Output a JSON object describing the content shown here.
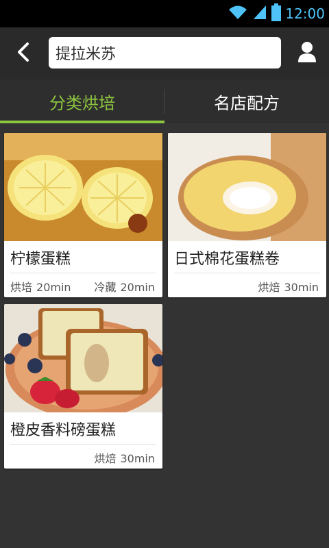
{
  "status_bar": {
    "time": "12:00"
  },
  "header": {
    "search_value": "提拉米苏",
    "back_icon": "chevron-left-icon",
    "user_icon": "user-icon"
  },
  "tabs": [
    {
      "label": "分类烘培",
      "active": true
    },
    {
      "label": "名店配方",
      "active": false
    }
  ],
  "colors": {
    "accent": "#8dc63f",
    "background": "#333333",
    "card": "#ffffff",
    "time": "#4fc3f7"
  },
  "recipes": [
    {
      "title": "柠檬蛋糕",
      "image": "lemon-cake-photo",
      "meta": [
        {
          "label": "烘培",
          "value": "20min"
        },
        {
          "label": "冷藏",
          "value": "20min"
        }
      ]
    },
    {
      "title": "日式棉花蛋糕卷",
      "image": "cotton-cake-roll-photo",
      "meta": [
        {
          "label": "烘焙",
          "value": "30min"
        }
      ]
    },
    {
      "title": "橙皮香料磅蛋糕",
      "image": "orange-peel-pound-cake-photo",
      "meta": [
        {
          "label": "烘焙",
          "value": "30min"
        }
      ]
    }
  ]
}
